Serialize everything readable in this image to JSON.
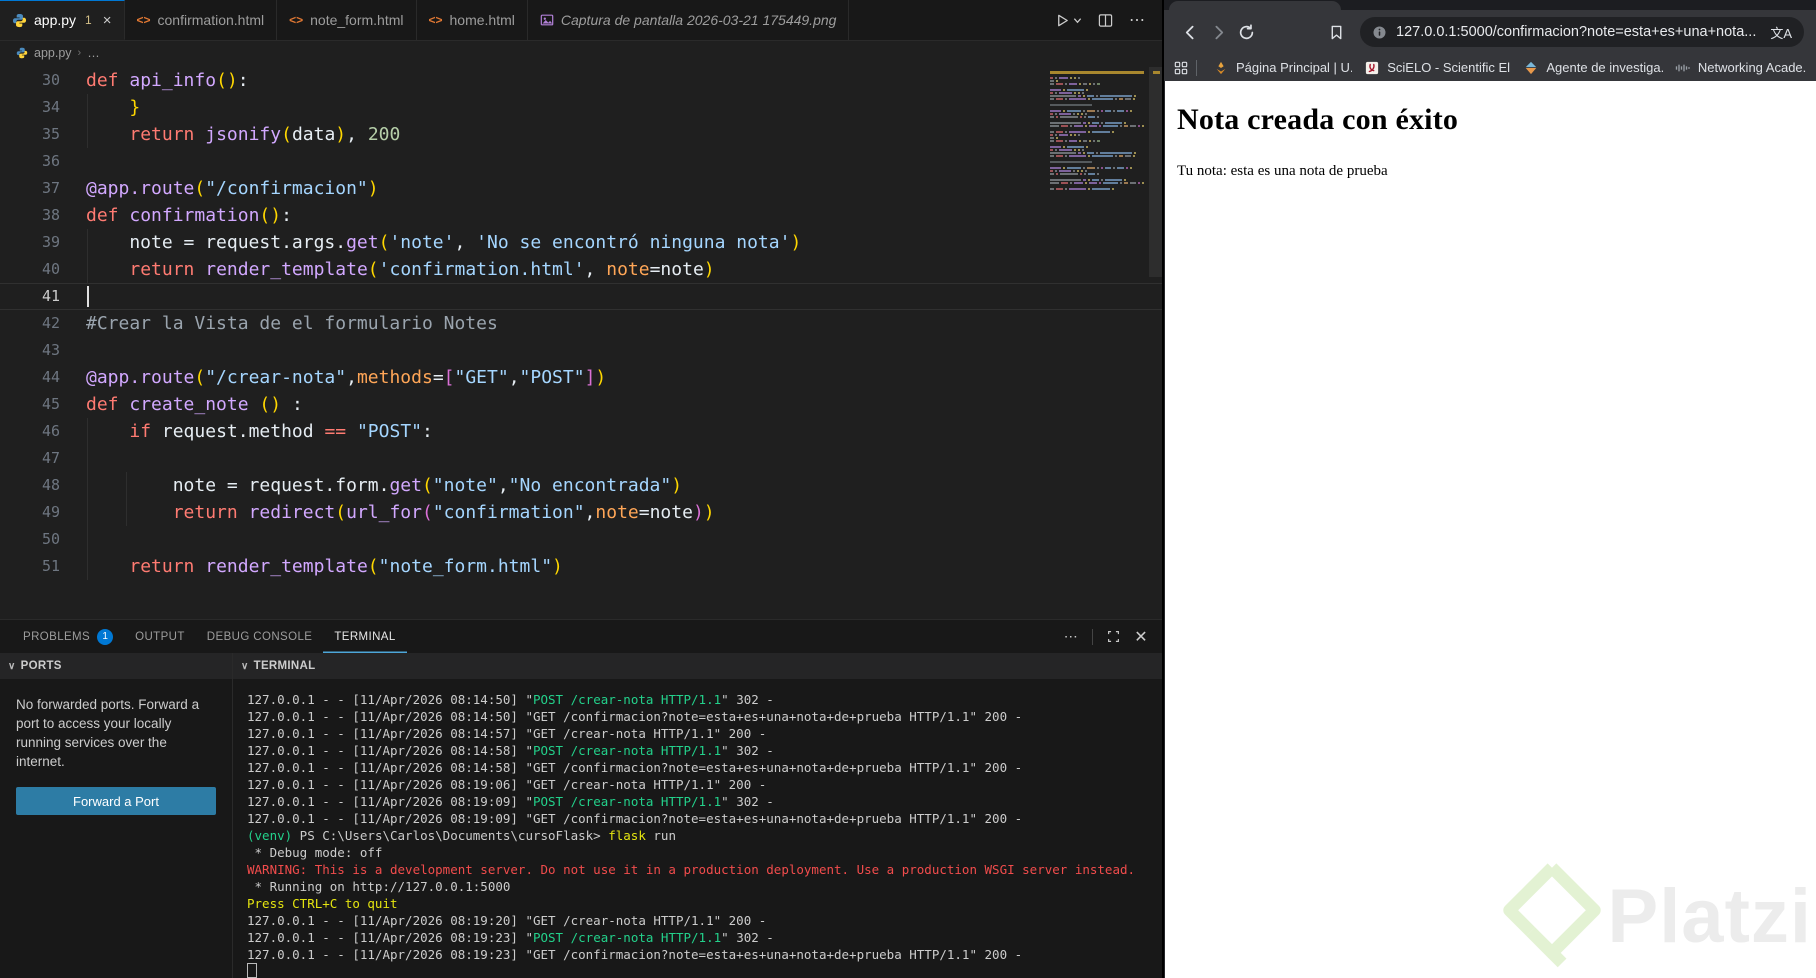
{
  "vscode": {
    "tabs": [
      {
        "label": "app.py",
        "badge": "1",
        "close": "×"
      },
      {
        "label": "confirmation.html"
      },
      {
        "label": "note_form.html"
      },
      {
        "label": "home.html"
      },
      {
        "label": "Captura de pantalla 2026-03-21 175449.png"
      }
    ],
    "breadcrumb": {
      "file": "app.py",
      "more": "…"
    },
    "editor_lines": [
      {
        "n": "30",
        "g": 0,
        "tokens": [
          [
            "k",
            "def"
          ],
          [
            "pl",
            " "
          ],
          [
            "fn",
            "api_info"
          ],
          [
            "b1",
            "("
          ],
          [
            "b1",
            ")"
          ],
          [
            "pl",
            ":"
          ]
        ]
      },
      {
        "n": "34",
        "g": 1,
        "tokens": [
          [
            "pl",
            "    "
          ],
          [
            "b1",
            "}"
          ]
        ]
      },
      {
        "n": "35",
        "g": 1,
        "tokens": [
          [
            "pl",
            "    "
          ],
          [
            "k",
            "return"
          ],
          [
            "pl",
            " "
          ],
          [
            "fn",
            "jsonify"
          ],
          [
            "b1",
            "("
          ],
          [
            "pl",
            "data"
          ],
          [
            "b1",
            ")"
          ],
          [
            "pl",
            ", "
          ],
          [
            "num",
            "200"
          ]
        ]
      },
      {
        "n": "36",
        "g": 0,
        "tokens": []
      },
      {
        "n": "37",
        "g": 0,
        "tokens": [
          [
            "fn",
            "@app.route"
          ],
          [
            "b1",
            "("
          ],
          [
            "str",
            "\"/confirmacion\""
          ],
          [
            "b1",
            ")"
          ]
        ]
      },
      {
        "n": "38",
        "g": 0,
        "tokens": [
          [
            "k",
            "def"
          ],
          [
            "pl",
            " "
          ],
          [
            "fn",
            "confirmation"
          ],
          [
            "b1",
            "("
          ],
          [
            "b1",
            ")"
          ],
          [
            "pl",
            ":"
          ]
        ]
      },
      {
        "n": "39",
        "g": 1,
        "tokens": [
          [
            "pl",
            "    note = request.args."
          ],
          [
            "fn",
            "get"
          ],
          [
            "b1",
            "("
          ],
          [
            "str",
            "'note'"
          ],
          [
            "pl",
            ", "
          ],
          [
            "str",
            "'No se encontró ninguna nota'"
          ],
          [
            "b1",
            ")"
          ]
        ]
      },
      {
        "n": "40",
        "g": 1,
        "tokens": [
          [
            "pl",
            "    "
          ],
          [
            "k",
            "return"
          ],
          [
            "pl",
            " "
          ],
          [
            "fn",
            "render_template"
          ],
          [
            "b1",
            "("
          ],
          [
            "str",
            "'confirmation.html'"
          ],
          [
            "pl",
            ", "
          ],
          [
            "param",
            "note"
          ],
          [
            "pl",
            "=note"
          ],
          [
            "b1",
            ")"
          ]
        ]
      },
      {
        "n": "41",
        "g": 0,
        "cursor": true,
        "current": true,
        "tokens": []
      },
      {
        "n": "42",
        "g": 0,
        "tokens": [
          [
            "cmt",
            "#Crear la Vista de el formulario Notes"
          ]
        ]
      },
      {
        "n": "43",
        "g": 0,
        "tokens": []
      },
      {
        "n": "44",
        "g": 0,
        "tokens": [
          [
            "fn",
            "@app.route"
          ],
          [
            "b1",
            "("
          ],
          [
            "str",
            "\"/crear-nota\""
          ],
          [
            "pl",
            ","
          ],
          [
            "param",
            "methods"
          ],
          [
            "pl",
            "="
          ],
          [
            "b2",
            "["
          ],
          [
            "str",
            "\"GET\""
          ],
          [
            "pl",
            ","
          ],
          [
            "str",
            "\"POST\""
          ],
          [
            "b2",
            "]"
          ],
          [
            "b1",
            ")"
          ]
        ]
      },
      {
        "n": "45",
        "g": 0,
        "tokens": [
          [
            "k",
            "def"
          ],
          [
            "pl",
            " "
          ],
          [
            "fn",
            "create_note"
          ],
          [
            "pl",
            " "
          ],
          [
            "b1",
            "("
          ],
          [
            "b1",
            ")"
          ],
          [
            "pl",
            " :"
          ]
        ]
      },
      {
        "n": "46",
        "g": 1,
        "tokens": [
          [
            "pl",
            "    "
          ],
          [
            "k",
            "if"
          ],
          [
            "pl",
            " request.method "
          ],
          [
            "k",
            "=="
          ],
          [
            "pl",
            " "
          ],
          [
            "str",
            "\"POST\""
          ],
          [
            "pl",
            ":"
          ]
        ]
      },
      {
        "n": "47",
        "g": 1,
        "tokens": []
      },
      {
        "n": "48",
        "g": 2,
        "tokens": [
          [
            "pl",
            "        note = request.form."
          ],
          [
            "fn",
            "get"
          ],
          [
            "b1",
            "("
          ],
          [
            "str",
            "\"note\""
          ],
          [
            "pl",
            ","
          ],
          [
            "str",
            "\"No encontrada\""
          ],
          [
            "b1",
            ")"
          ]
        ]
      },
      {
        "n": "49",
        "g": 2,
        "tokens": [
          [
            "pl",
            "        "
          ],
          [
            "k",
            "return"
          ],
          [
            "pl",
            " "
          ],
          [
            "fn",
            "redirect"
          ],
          [
            "b1",
            "("
          ],
          [
            "fn",
            "url_for"
          ],
          [
            "b2",
            "("
          ],
          [
            "str",
            "\"confirmation\""
          ],
          [
            "pl",
            ","
          ],
          [
            "param",
            "note"
          ],
          [
            "pl",
            "=note"
          ],
          [
            "b2",
            ")"
          ],
          [
            "b1",
            ")"
          ]
        ]
      },
      {
        "n": "50",
        "g": 1,
        "tokens": []
      },
      {
        "n": "51",
        "g": 1,
        "tokens": [
          [
            "pl",
            "    "
          ],
          [
            "k",
            "return"
          ],
          [
            "pl",
            " "
          ],
          [
            "fn",
            "render_template"
          ],
          [
            "b1",
            "("
          ],
          [
            "str",
            "\"note_form.html\""
          ],
          [
            "b1",
            ")"
          ]
        ]
      }
    ],
    "panel": {
      "tabs": [
        "PROBLEMS",
        "OUTPUT",
        "DEBUG CONSOLE",
        "TERMINAL"
      ],
      "problems_badge": "1"
    },
    "ports": {
      "title": "PORTS",
      "message": "No forwarded ports. Forward a port to access your locally running services over the internet.",
      "button": "Forward a Port"
    },
    "terminal": {
      "title": "TERMINAL",
      "lines": [
        {
          "segs": [
            [
              "p",
              "127.0.0.1 - - [11/Apr/2026 08:14:50] \""
            ],
            [
              "g",
              "POST /crear-nota HTTP/1.1"
            ],
            [
              "p",
              "\" 302 -"
            ]
          ]
        },
        {
          "segs": [
            [
              "p",
              "127.0.0.1 - - [11/Apr/2026 08:14:50] \"GET /confirmacion?note=esta+es+una+nota+de+prueba HTTP/1.1\" 200 -"
            ]
          ]
        },
        {
          "segs": [
            [
              "p",
              "127.0.0.1 - - [11/Apr/2026 08:14:57] \"GET /crear-nota HTTP/1.1\" 200 -"
            ]
          ]
        },
        {
          "segs": [
            [
              "p",
              "127.0.0.1 - - [11/Apr/2026 08:14:58] \""
            ],
            [
              "g",
              "POST /crear-nota HTTP/1.1"
            ],
            [
              "p",
              "\" 302 -"
            ]
          ]
        },
        {
          "segs": [
            [
              "p",
              "127.0.0.1 - - [11/Apr/2026 08:14:58] \"GET /confirmacion?note=esta+es+una+nota+de+prueba HTTP/1.1\" 200 -"
            ]
          ]
        },
        {
          "segs": [
            [
              "p",
              "127.0.0.1 - - [11/Apr/2026 08:19:06] \"GET /crear-nota HTTP/1.1\" 200 -"
            ]
          ]
        },
        {
          "segs": [
            [
              "p",
              "127.0.0.1 - - [11/Apr/2026 08:19:09] \""
            ],
            [
              "g",
              "POST /crear-nota HTTP/1.1"
            ],
            [
              "p",
              "\" 302 -"
            ]
          ]
        },
        {
          "segs": [
            [
              "p",
              "127.0.0.1 - - [11/Apr/2026 08:19:09] \"GET /confirmacion?note=esta+es+una+nota+de+prueba HTTP/1.1\" 200 -"
            ]
          ]
        },
        {
          "segs": [
            [
              "g",
              "(venv)"
            ],
            [
              "p",
              " PS C:\\Users\\Carlos\\Documents\\cursoFlask> "
            ],
            [
              "y",
              "flask"
            ],
            [
              "p",
              " run"
            ]
          ]
        },
        {
          "segs": [
            [
              "p",
              " * Debug mode: off"
            ]
          ]
        },
        {
          "segs": [
            [
              "r",
              "WARNING: This is a development server. Do not use it in a production deployment. Use a production WSGI server instead."
            ]
          ]
        },
        {
          "segs": [
            [
              "p",
              " * Running on http://127.0.0.1:5000"
            ]
          ]
        },
        {
          "segs": [
            [
              "y",
              "Press CTRL+C to quit"
            ]
          ]
        },
        {
          "segs": [
            [
              "p",
              "127.0.0.1 - - [11/Apr/2026 08:19:20] \"GET /crear-nota HTTP/1.1\" 200 -"
            ]
          ]
        },
        {
          "segs": [
            [
              "p",
              "127.0.0.1 - - [11/Apr/2026 08:19:23] \""
            ],
            [
              "g",
              "POST /crear-nota HTTP/1.1"
            ],
            [
              "p",
              "\" 302 -"
            ]
          ]
        },
        {
          "segs": [
            [
              "p",
              "127.0.0.1 - - [11/Apr/2026 08:19:23] \"GET /confirmacion?note=esta+es+una+nota+de+prueba HTTP/1.1\" 200 -"
            ]
          ]
        },
        {
          "segs": [],
          "cursor": true
        }
      ]
    }
  },
  "browser": {
    "url": "127.0.0.1:5000/confirmacion?note=esta+es+una+nota...",
    "translate_glyph": "文A",
    "bookmarks": [
      {
        "label": "Página Principal | U..."
      },
      {
        "label": "SciELO - Scientific El..."
      },
      {
        "label": "Agente de investiga..."
      },
      {
        "label": "Networking Acade..."
      }
    ],
    "page": {
      "heading": "Nota creada con éxito",
      "body": "Tu nota: esta es una nota de prueba",
      "watermark": "Platzi"
    }
  },
  "colors": {
    "accent_blue": "#0078d4",
    "terminal_green": "#23d18b",
    "terminal_red": "#f14c4c",
    "terminal_yellow": "#e5e510",
    "button_blue": "#2d7ca5",
    "watermark_green": "#e3f2d3"
  }
}
